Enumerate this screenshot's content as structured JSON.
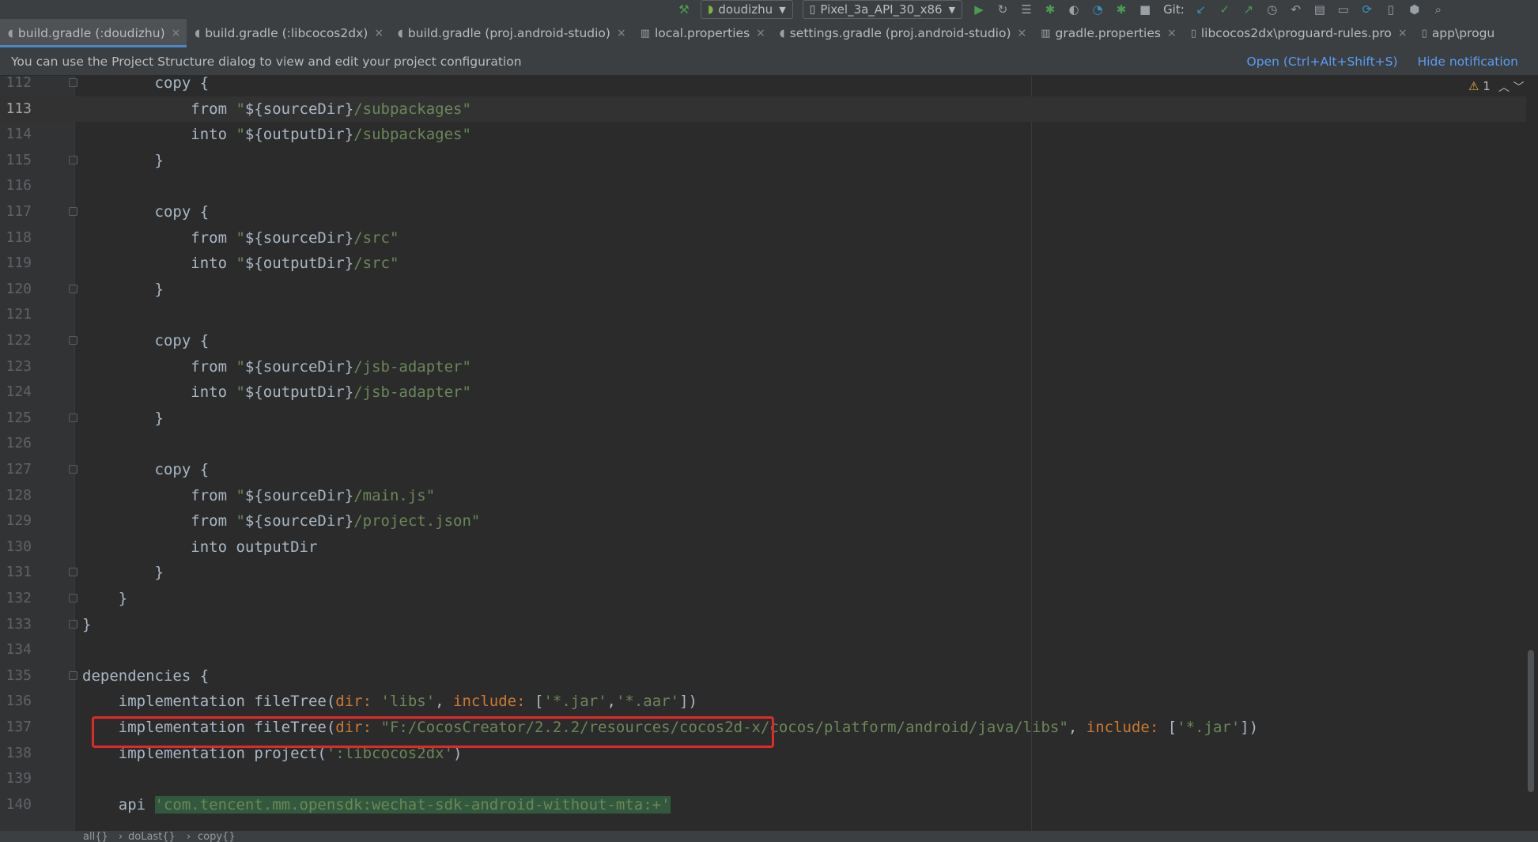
{
  "toolbar": {
    "module": "doudizhu",
    "device": "Pixel_3a_API_30_x86",
    "git_label": "Git:",
    "icons": [
      "hammer-icon",
      "run-icon",
      "rerun-icon",
      "coverage-icon",
      "debug-icon",
      "profile-icon",
      "apply-changes-icon",
      "attach-debugger-icon",
      "stop-icon",
      "git-update-icon",
      "git-commit-icon",
      "git-push-icon",
      "git-history-icon",
      "git-rollback-icon",
      "project-structure-icon",
      "terminal-icon",
      "sync-icon",
      "device-manager-icon",
      "sdk-manager-icon",
      "search-icon"
    ]
  },
  "tabs": [
    {
      "label": "build.gradle (:doudizhu)",
      "active": true
    },
    {
      "label": "build.gradle (:libcocos2dx)",
      "active": false
    },
    {
      "label": "build.gradle (proj.android-studio)",
      "active": false
    },
    {
      "label": "local.properties",
      "active": false
    },
    {
      "label": "settings.gradle (proj.android-studio)",
      "active": false
    },
    {
      "label": "gradle.properties",
      "active": false
    },
    {
      "label": "libcocos2dx\\proguard-rules.pro",
      "active": false
    },
    {
      "label": "app\\progu",
      "active": false
    }
  ],
  "notification": {
    "message": "You can use the Project Structure dialog to view and edit your project configuration",
    "open_link": "Open (Ctrl+Alt+Shift+S)",
    "hide_link": "Hide notification"
  },
  "editor": {
    "warning_count": "1",
    "current_line": "113",
    "lines": [
      {
        "num": "112",
        "text": "        copy {"
      },
      {
        "num": "113",
        "text": "            from \"${sourceDir}/subpackages\""
      },
      {
        "num": "114",
        "text": "            into \"${outputDir}/subpackages\""
      },
      {
        "num": "115",
        "text": "        }"
      },
      {
        "num": "116",
        "text": ""
      },
      {
        "num": "117",
        "text": "        copy {"
      },
      {
        "num": "118",
        "text": "            from \"${sourceDir}/src\""
      },
      {
        "num": "119",
        "text": "            into \"${outputDir}/src\""
      },
      {
        "num": "120",
        "text": "        }"
      },
      {
        "num": "121",
        "text": ""
      },
      {
        "num": "122",
        "text": "        copy {"
      },
      {
        "num": "123",
        "text": "            from \"${sourceDir}/jsb-adapter\""
      },
      {
        "num": "124",
        "text": "            into \"${outputDir}/jsb-adapter\""
      },
      {
        "num": "125",
        "text": "        }"
      },
      {
        "num": "126",
        "text": ""
      },
      {
        "num": "127",
        "text": "        copy {"
      },
      {
        "num": "128",
        "text": "            from \"${sourceDir}/main.js\""
      },
      {
        "num": "129",
        "text": "            from \"${sourceDir}/project.json\""
      },
      {
        "num": "130",
        "text": "            into outputDir"
      },
      {
        "num": "131",
        "text": "        }"
      },
      {
        "num": "132",
        "text": "    }"
      },
      {
        "num": "133",
        "text": "}"
      },
      {
        "num": "134",
        "text": ""
      },
      {
        "num": "135",
        "text": "dependencies {"
      },
      {
        "num": "136",
        "text": "    implementation fileTree(dir: 'libs', include: ['*.jar','*.aar'])"
      },
      {
        "num": "137",
        "text": "    implementation fileTree(dir: \"F:/CocosCreator/2.2.2/resources/cocos2d-x/cocos/platform/android/java/libs\", include: ['*.jar'])"
      },
      {
        "num": "138",
        "text": "    implementation project(':libcocos2dx')"
      },
      {
        "num": "139",
        "text": ""
      },
      {
        "num": "140",
        "text": "    api 'com.tencent.mm.opensdk:wechat-sdk-android-without-mta:+'"
      }
    ]
  },
  "breadcrumb": [
    "all{}",
    "doLast{}",
    "copy{}"
  ]
}
